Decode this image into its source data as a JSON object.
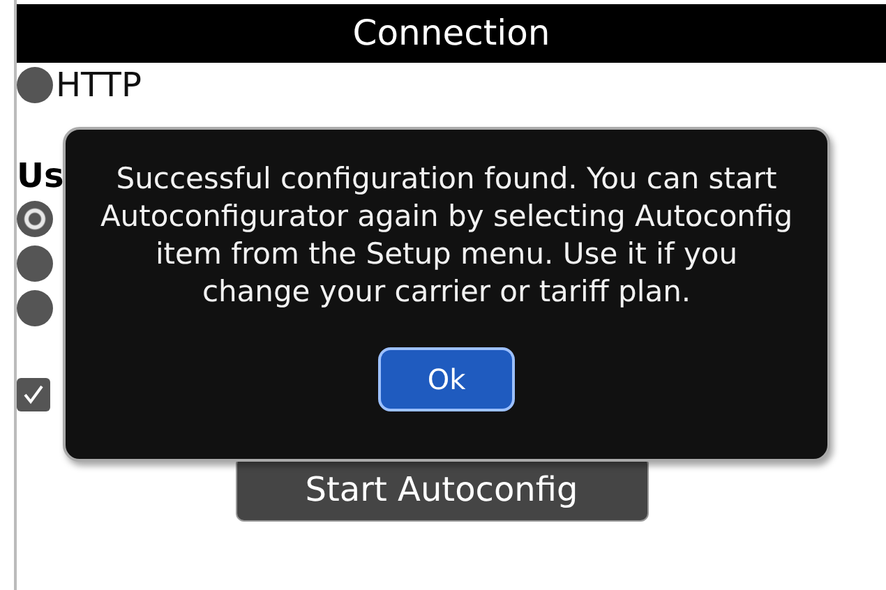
{
  "title": "Connection",
  "protocols": [
    {
      "label": "HTTP",
      "selected": false
    }
  ],
  "transport": {
    "heading": "Us",
    "options": [
      {
        "selected": true
      },
      {
        "selected": false
      },
      {
        "selected": false
      }
    ]
  },
  "wifi": {
    "checked": true
  },
  "start_button": "Start Autoconfig",
  "dialog": {
    "message": "Successful configuration found. You can start Autoconfigurator again by selecting Autoconfig item from the Setup menu. Use it if you change your carrier or tariff plan.",
    "button": "Ok"
  }
}
